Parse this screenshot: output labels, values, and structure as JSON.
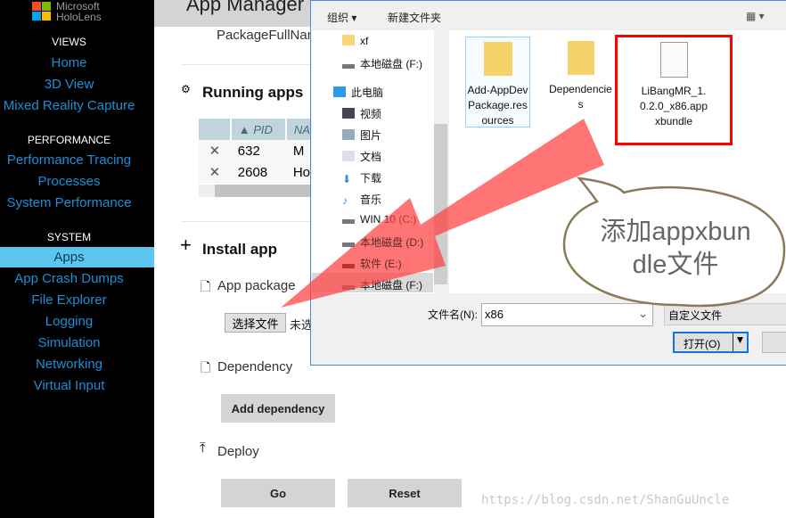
{
  "sidebar": {
    "logo": {
      "line1": "Microsoft",
      "line2": "HoloLens"
    },
    "sections": [
      {
        "title": "VIEWS",
        "items": [
          "Home",
          "3D View",
          "Mixed Reality Capture"
        ]
      },
      {
        "title": "PERFORMANCE",
        "items": [
          "Performance Tracing",
          "Processes",
          "System Performance"
        ]
      },
      {
        "title": "SYSTEM",
        "items": [
          "Apps",
          "App Crash Dumps",
          "File Explorer",
          "Logging",
          "Simulation",
          "Networking",
          "Virtual Input"
        ]
      }
    ],
    "active": "Apps",
    "accent": "#1b8fd6",
    "active_bg": "#5bc6f0"
  },
  "main": {
    "title": "App Manager",
    "package_label": "PackageFullName",
    "running": {
      "title": "Running apps",
      "columns": [
        "",
        "▲ PID",
        "NA"
      ],
      "rows": [
        {
          "pid": "632",
          "name": "M"
        },
        {
          "pid": "2608",
          "name": "Ho"
        }
      ]
    },
    "install": {
      "title": "Install app",
      "app_package": "App package",
      "choose_file": "选择文件",
      "no_file": "未选",
      "dependency": "Dependency",
      "add_dependency": "Add dependency",
      "deploy": "Deploy",
      "go": "Go",
      "reset": "Reset"
    }
  },
  "dialog": {
    "toolbar": {
      "organize": "组织 ▾",
      "new_folder": "新建文件夹"
    },
    "nav": [
      "xf",
      "本地磁盘 (F:)",
      "此电脑",
      "视频",
      "图片",
      "文档",
      "下载",
      "音乐",
      "WIN 10 (C:)",
      "本地磁盘 (D:)",
      "软件 (E:)",
      "本地磁盘 (F:)"
    ],
    "files": [
      "Add-AppDevPackage.resources",
      "Dependencies",
      "LiBangMR_1.0.2.0_x86.appxbundle"
    ],
    "filename_label": "文件名(N):",
    "filename_value": "x86",
    "filter": "自定义文件",
    "open": "打开(O)"
  },
  "annotation": {
    "bubble": "添加appxbundle文件",
    "highlight_color": "#ff0000",
    "arrow_color": "#ff4040"
  },
  "watermark": "https://blog.csdn.net/ShanGuUncle"
}
